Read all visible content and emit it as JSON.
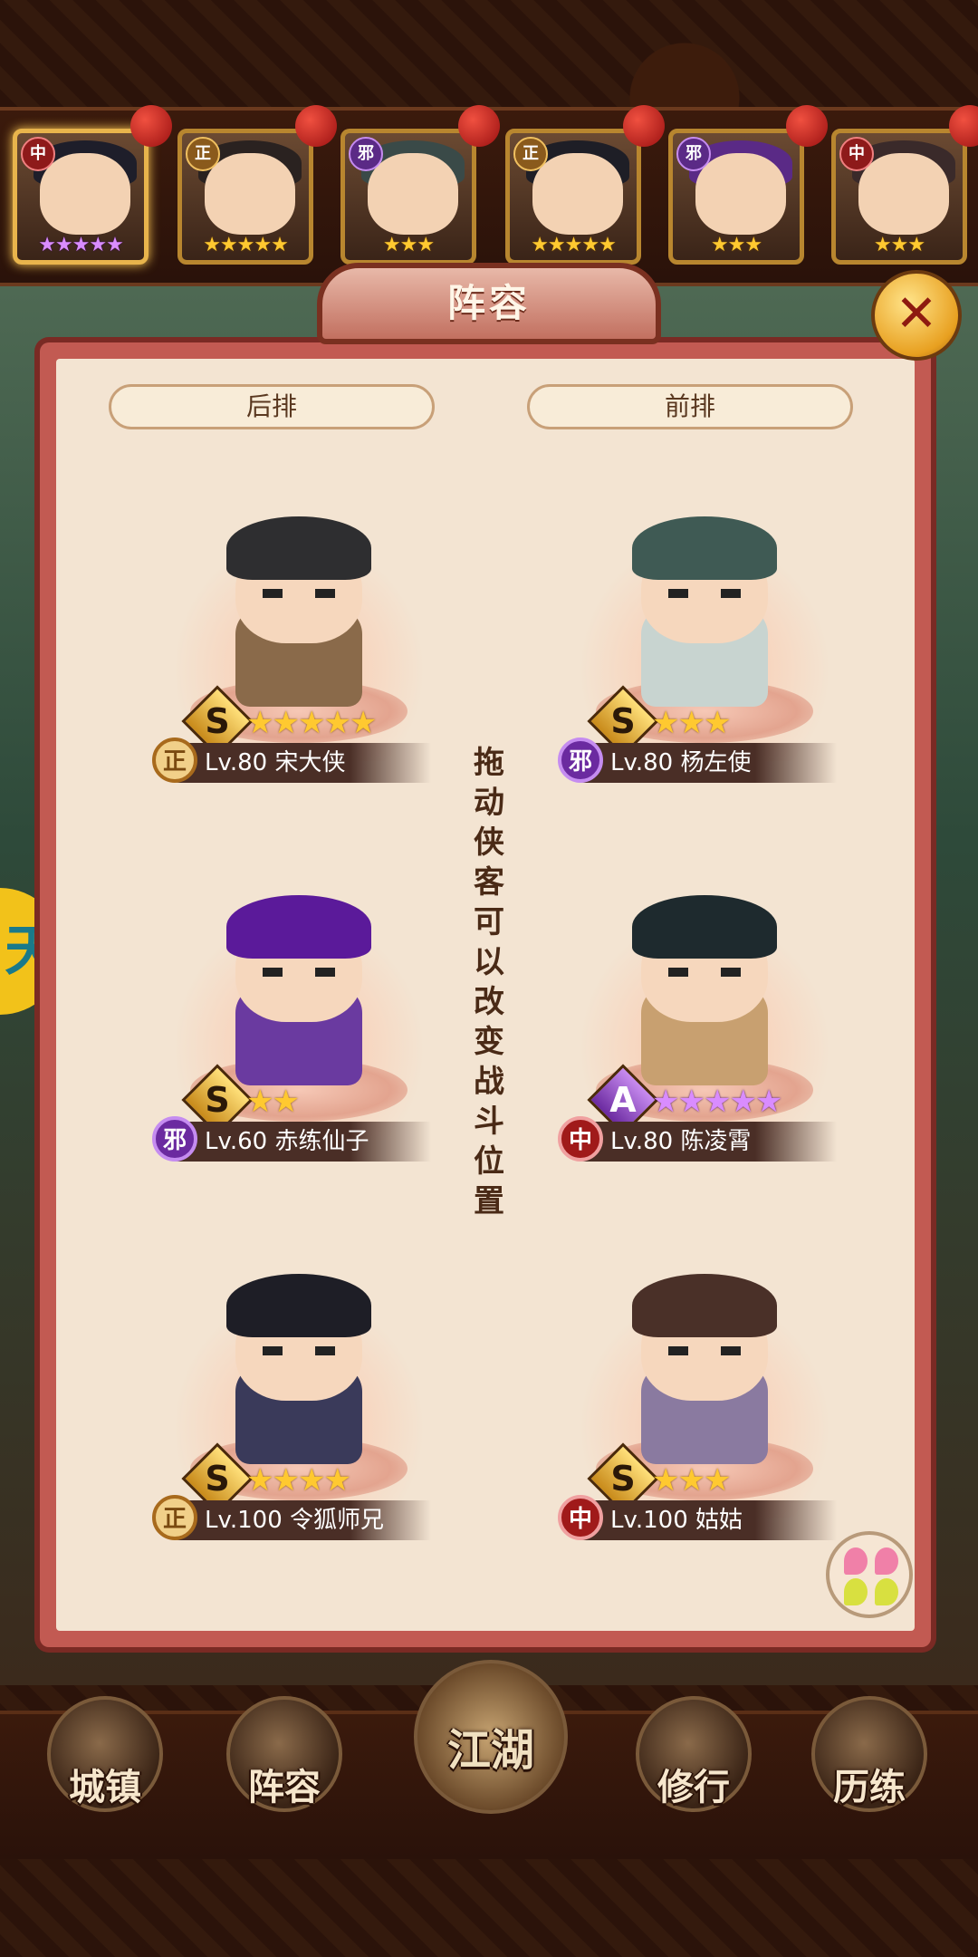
{
  "hero_strip": [
    {
      "faction": "中",
      "faction_class": "fac-zhong",
      "stars": "★★★★★",
      "star_color": "purple",
      "active": true,
      "hair": "#1e1e2a"
    },
    {
      "faction": "正",
      "faction_class": "fac-zheng",
      "stars": "★★★★★",
      "star_color": "gold",
      "active": false,
      "hair": "#2a2220"
    },
    {
      "faction": "邪",
      "faction_class": "fac-xie",
      "stars": "★★★",
      "star_color": "gold",
      "active": false,
      "hair": "#3a4a48"
    },
    {
      "faction": "正",
      "faction_class": "fac-zheng",
      "stars": "★★★★★",
      "star_color": "gold",
      "active": false,
      "hair": "#1e1e26"
    },
    {
      "faction": "邪",
      "faction_class": "fac-xie",
      "stars": "★★★",
      "star_color": "gold",
      "active": false,
      "hair": "#5a2a86"
    },
    {
      "faction": "中",
      "faction_class": "fac-zhong",
      "stars": "★★★",
      "star_color": "gold",
      "active": false,
      "hair": "#3a2a2a"
    }
  ],
  "panel": {
    "title": "阵容",
    "close_icon": "✕",
    "back_row_label": "后排",
    "front_row_label": "前排",
    "hint": "拖动侠客可以改变战斗位置"
  },
  "characters": [
    {
      "grade": "S",
      "stars": "★★★★★",
      "star_color": "gold",
      "faction": "正",
      "faction_class": "zheng",
      "name": "Lv.80 宋大侠",
      "hair": "#2e2e30",
      "robe": "#8a6a4a"
    },
    {
      "grade": "S",
      "stars": "★★★",
      "star_color": "gold",
      "faction": "邪",
      "faction_class": "xie",
      "name": "Lv.80 杨左使",
      "hair": "#3f5a54",
      "robe": "#c8d4d0"
    },
    {
      "grade": "S",
      "stars": "★★",
      "star_color": "gold",
      "faction": "邪",
      "faction_class": "xie",
      "name": "Lv.60 赤练仙子",
      "hair": "#5b1a9a",
      "robe": "#6a3aa0"
    },
    {
      "grade": "A",
      "stars": "★★★★★",
      "star_color": "purple",
      "faction": "中",
      "faction_class": "zhong",
      "name": "Lv.80 陈凌霄",
      "hair": "#1e2a2e",
      "robe": "#c8a070"
    },
    {
      "grade": "S",
      "stars": "★★★★",
      "star_color": "gold",
      "faction": "正",
      "faction_class": "zheng",
      "name": "Lv.100 令狐师兄",
      "hair": "#1e1e26",
      "robe": "#3a3a5a"
    },
    {
      "grade": "S",
      "stars": "★★★",
      "star_color": "gold",
      "faction": "中",
      "faction_class": "zhong",
      "name": "Lv.100 姑姑",
      "hair": "#4a3028",
      "robe": "#8a7aa0"
    }
  ],
  "side_tab": {
    "label": "天"
  },
  "nav": [
    {
      "label": "城镇",
      "icon": "town-icon"
    },
    {
      "label": "阵容",
      "icon": "lineup-icon"
    },
    {
      "label": "江湖",
      "icon": "jianghu-scroll-icon"
    },
    {
      "label": "修行",
      "icon": "cultivation-icon"
    },
    {
      "label": "历练",
      "icon": "training-icon"
    }
  ],
  "colors": {
    "panel_border": "#c25a52",
    "panel_bg": "#f3e4d2",
    "gold_star": "#ffc930",
    "purple_star": "#d98cff"
  }
}
